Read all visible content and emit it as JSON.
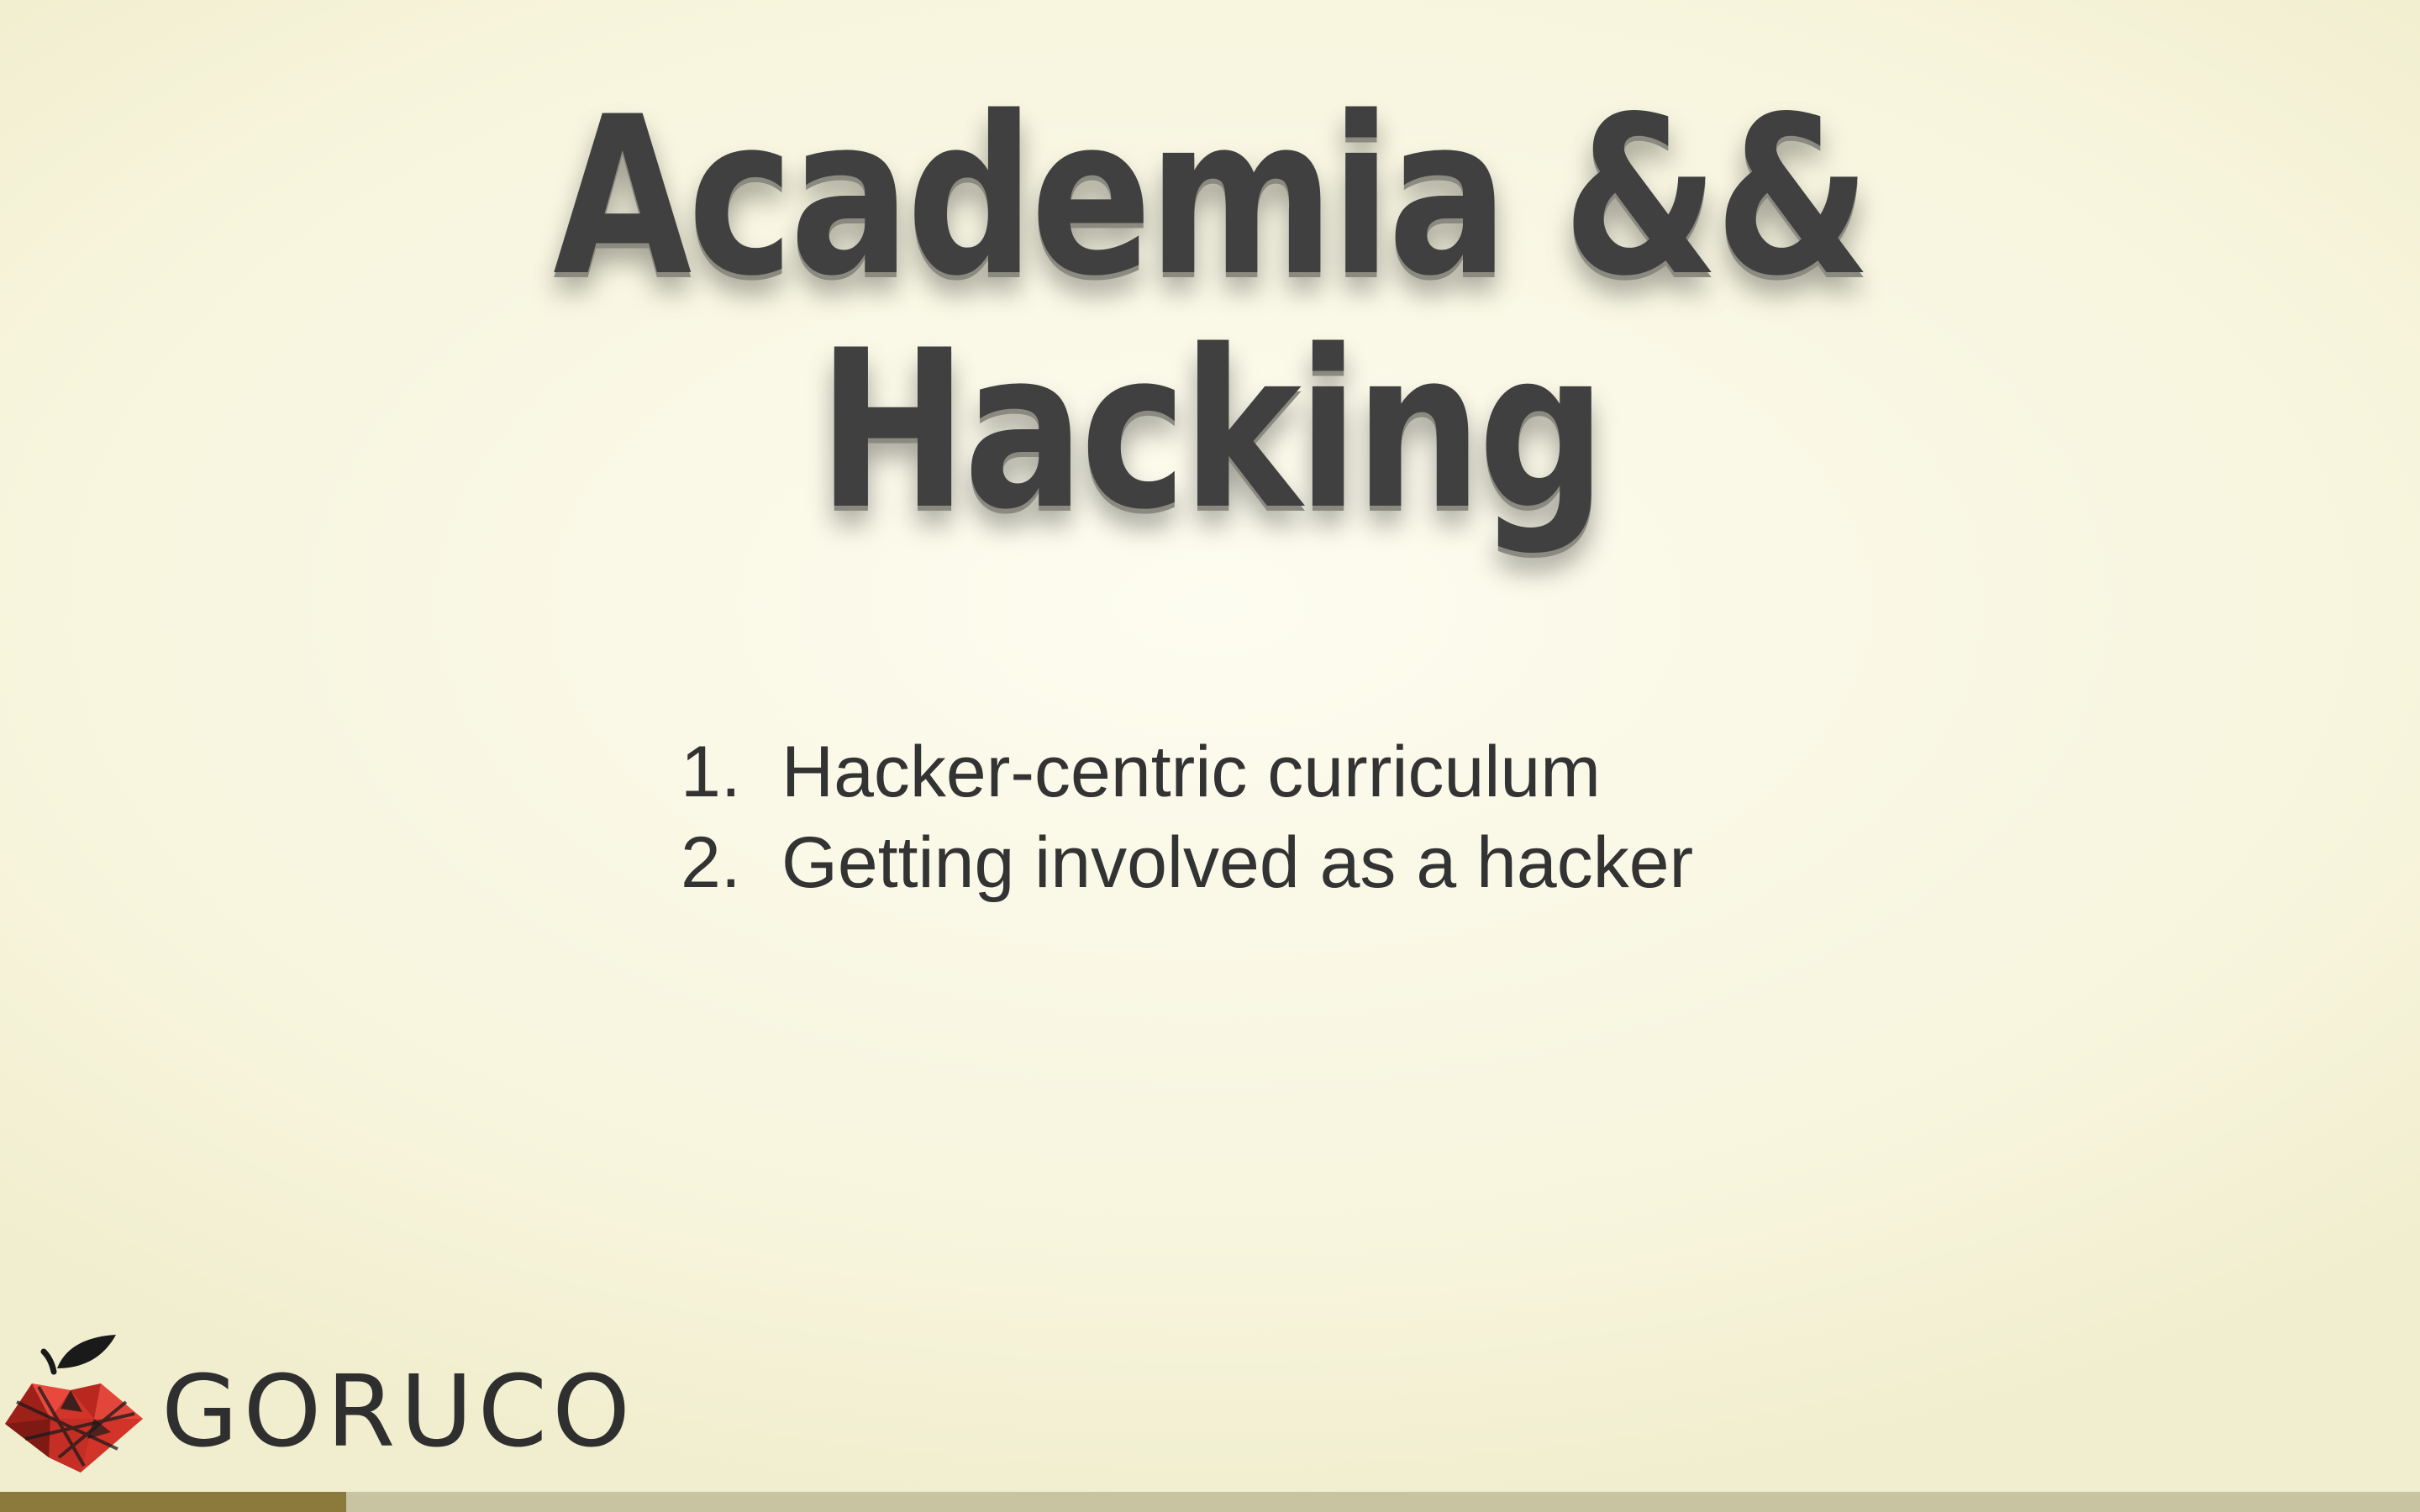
{
  "slide": {
    "title_line1": "Academia &&",
    "title_line2": "Hacking",
    "agenda": [
      {
        "number": "1.",
        "text": "Hacker-centric curriculum"
      },
      {
        "number": "2.",
        "text": "Getting involved as a hacker"
      }
    ]
  },
  "brand": {
    "logo_text": "GORUCO",
    "logo_icon": "apple-logo-icon"
  },
  "progress": {
    "fraction": 0.143
  },
  "colors": {
    "background": "#f7f5dd",
    "title": "#404040",
    "text": "#333333",
    "logo_red": "#d2342a",
    "progress_fill": "#8b7a3c",
    "progress_track": "#c8c4a2"
  }
}
